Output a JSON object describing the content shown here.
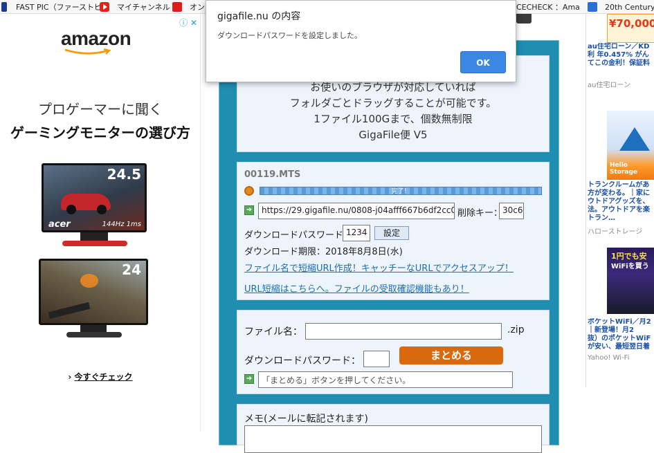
{
  "bookmarks": [
    {
      "label": "FAST PIC（ファーストピ",
      "icon": "fastpic-icon"
    },
    {
      "label": "マイチャンネル",
      "icon": "youtube-icon"
    },
    {
      "label": "オン",
      "icon": "red-square-icon"
    },
    {
      "label": "CECHECK ：Ama",
      "icon": "check-icon"
    },
    {
      "label": "20th Century",
      "icon": "twentieth-icon"
    }
  ],
  "left_ad": {
    "brand": "amazon",
    "line1": "プロゲーマーに聞く",
    "line2": "ゲーミングモニターの選び方",
    "monitor1_size": "24.5",
    "monitor1_brand": "acer",
    "monitor1_spec": "144Hz 1ms",
    "monitor2_size": "24",
    "cta": "今すぐチェック"
  },
  "info_panel": {
    "line1": "お使いのブラウザが対応していれば",
    "line2": "フォルダごとドラッグすることが可能です。",
    "line3": "1ファイル100Gまで、個数無制限",
    "line4": "GigaFile便 V5"
  },
  "upload": {
    "filename": "00119.MTS",
    "progress_label": "完了！",
    "progress_percent": 100,
    "url": "https://29.gigafile.nu/0808-j04afff667b6df2cc0",
    "delete_key_label": "削除キー：",
    "delete_key": "30c6",
    "password_label": "ダウンロードパスワード：",
    "password": "1234",
    "set_button": "設定",
    "expiry": "ダウンロード期限：2018年8月8日(水)",
    "link1": "ファイル名で短縮URL作成！キャッチーなURLでアクセスアップ！",
    "link2": "URL短縮はこちらへ。ファイルの受取確認機能もあり！"
  },
  "bundle": {
    "filename_label": "ファイル名：",
    "filename_value": "",
    "ext": ".zip",
    "password_label": "ダウンロードパスワード：",
    "password_value": "",
    "button": "まとめる",
    "status_placeholder": "「まとめる」ボタンを押してください。"
  },
  "memo": {
    "label": "メモ(メールに転記されます)"
  },
  "right_ads": [
    {
      "price": "¥70,000",
      "link": "au住宅ローン／KD",
      "link2": "利 年0.457% がん",
      "link3": "てこの金利！保証料",
      "source": "au住宅ローン"
    },
    {
      "img_text": "Hello Storage",
      "link": "トランクルームがあ",
      "link2": "方が変わる。｜家に",
      "link3": "ウトドアグッズを、",
      "link4": "法。アウトドアを楽",
      "link5": "トラン…",
      "source": "ハローストレージ"
    },
    {
      "img_text": "1円でも安",
      "img_text2": "WiFiを買う",
      "link": "ポケットWiFi／月2",
      "link2": "｜新登場！月2",
      "link3": "抜）のポケットWiF",
      "link4": "が安い、最短翌日着",
      "source": "Yahoo! Wi-Fi"
    }
  ],
  "dialog": {
    "title": "gigafile.nu の内容",
    "message": "ダウンロードパスワードを設定しました。",
    "ok": "OK"
  },
  "colors": {
    "teal_frame": "#1f8eb0",
    "panel_bg": "#eef4fb",
    "orange_button": "#d9690c",
    "ok_button": "#3b87e6",
    "link": "#1a6fb3"
  }
}
